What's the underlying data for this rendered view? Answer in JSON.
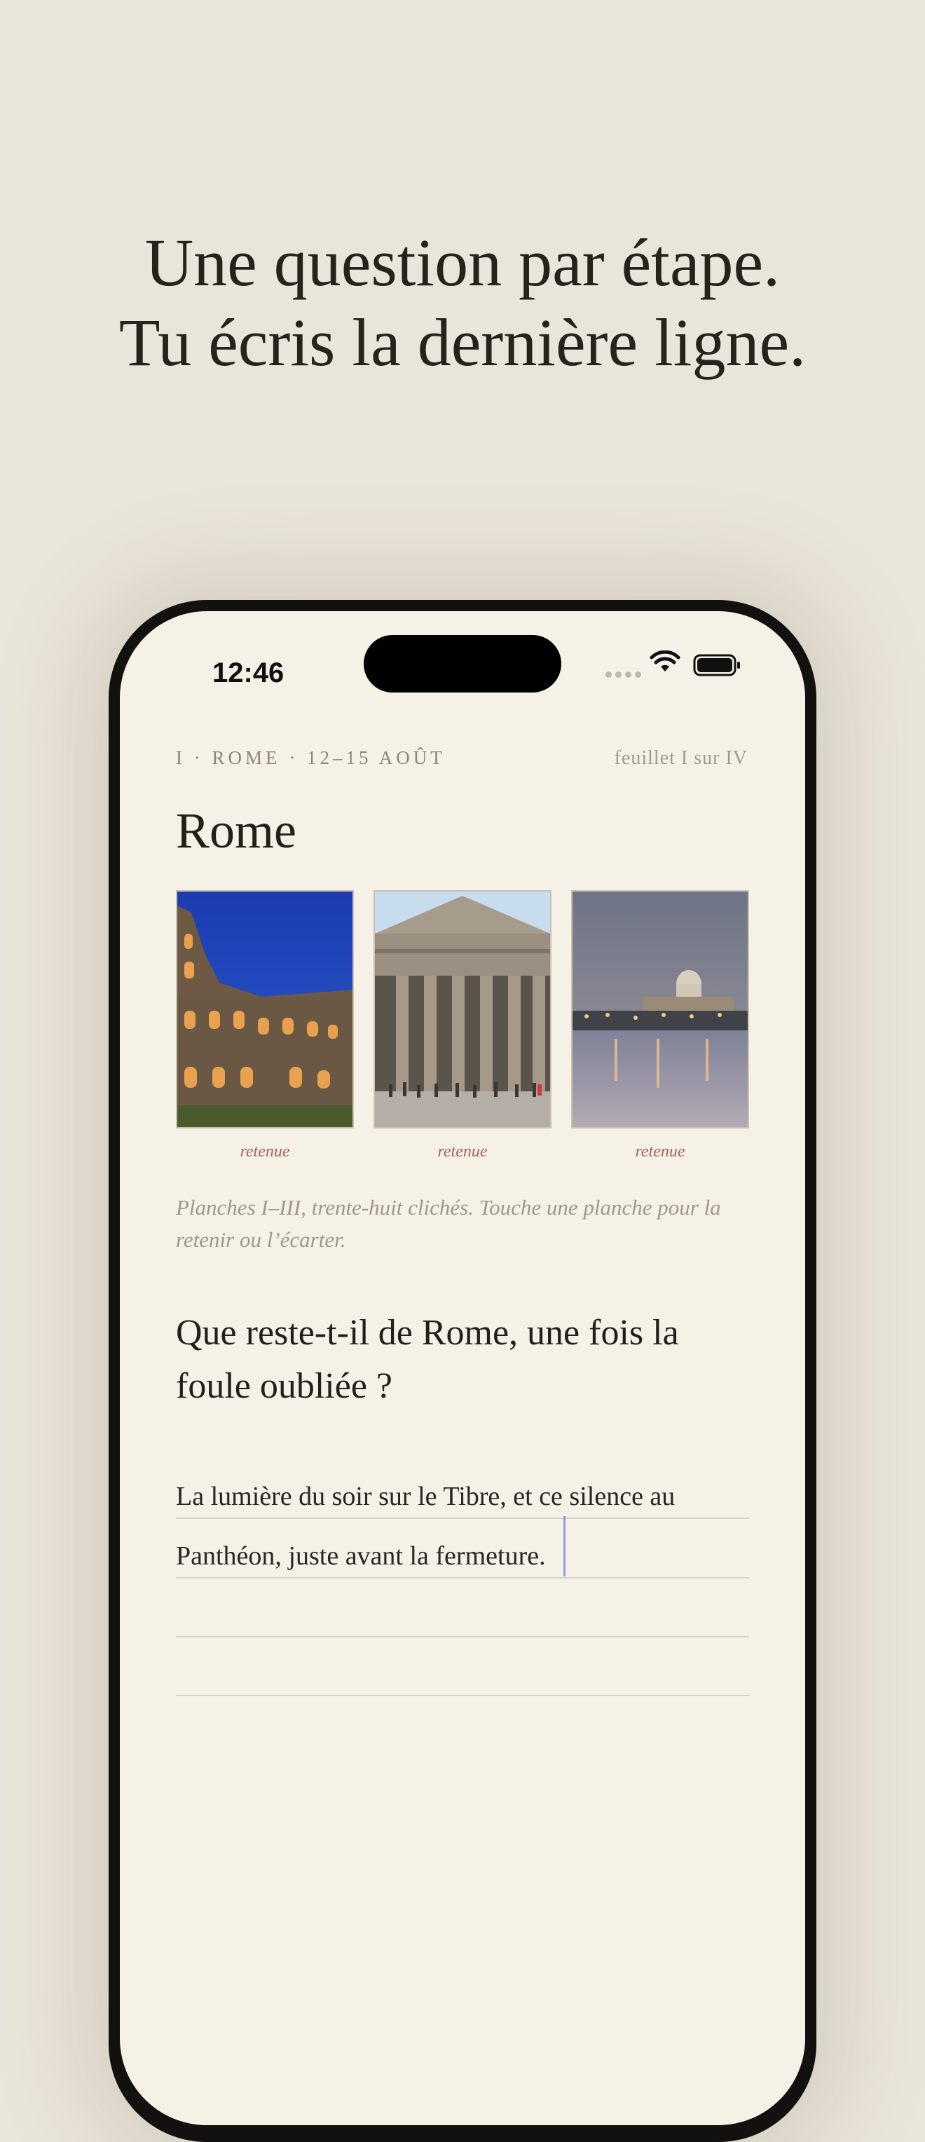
{
  "headline": {
    "line1": "Une question par étape.",
    "line2": "Tu écris la dernière ligne."
  },
  "status_bar": {
    "time": "12:46",
    "icons": [
      "cellular-icon",
      "wifi-icon",
      "battery-icon"
    ]
  },
  "sheet": {
    "meta_left": "I · ROME · 12–15 AOÛT",
    "meta_right": "feuillet I sur IV",
    "title": "Rome",
    "plates": [
      {
        "image": "colosseum-photo",
        "status": "retenue"
      },
      {
        "image": "pantheon-photo",
        "status": "retenue"
      },
      {
        "image": "tiber-st-peters-photo",
        "status": "retenue"
      }
    ],
    "caption": "Planches I–III, trente-huit clichés. Touche une planche pour la retenir ou l’écarter.",
    "question_line1": "Que reste-t-il de Rome, une fois la",
    "question_line2": "foule oubliée ?",
    "answer_line1": "La lumière du soir sur le Tibre, et ce silence au",
    "answer_line2": "Panthéon, juste avant la fermeture."
  },
  "colors": {
    "background": "#EAE5DA",
    "paper": "#F6F1E7",
    "ink": "#231F19",
    "accent": "#A4665A",
    "caret": "#8E9FD8"
  }
}
